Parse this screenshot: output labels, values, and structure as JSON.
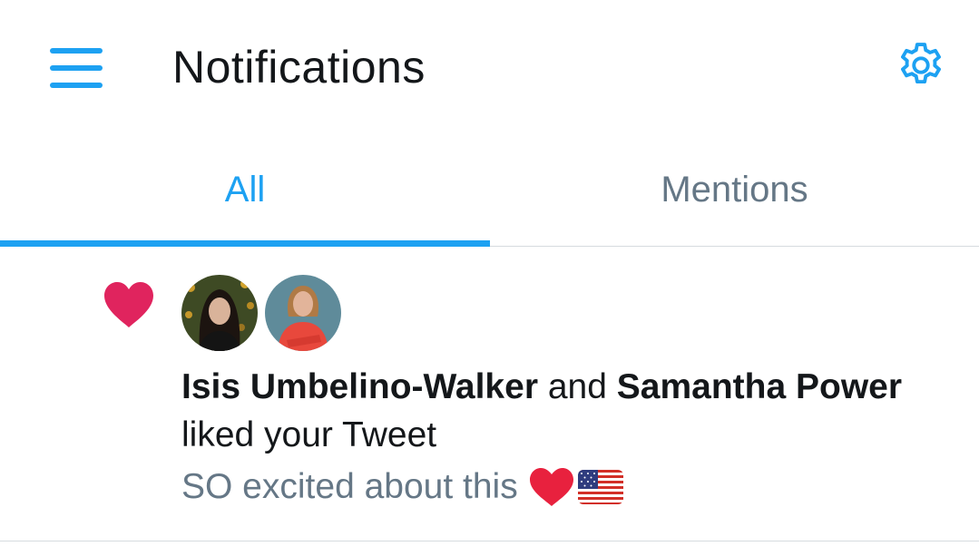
{
  "header": {
    "title": "Notifications"
  },
  "tabs": [
    {
      "label": "All",
      "active": true
    },
    {
      "label": "Mentions",
      "active": false
    }
  ],
  "notification": {
    "type": "like",
    "user1": "Isis Umbelino-Walker",
    "conjunction": " and ",
    "user2": "Samantha Power",
    "action": "liked your Tweet",
    "tweet_preview": "SO excited about this"
  },
  "colors": {
    "accent": "#1da1f2",
    "like_heart": "#e0245e",
    "text_primary": "#14171a",
    "text_secondary": "#657786"
  },
  "icons": {
    "menu": "hamburger-menu-icon",
    "settings": "gear-icon",
    "like": "heart-icon",
    "flag": "us-flag-emoji"
  }
}
